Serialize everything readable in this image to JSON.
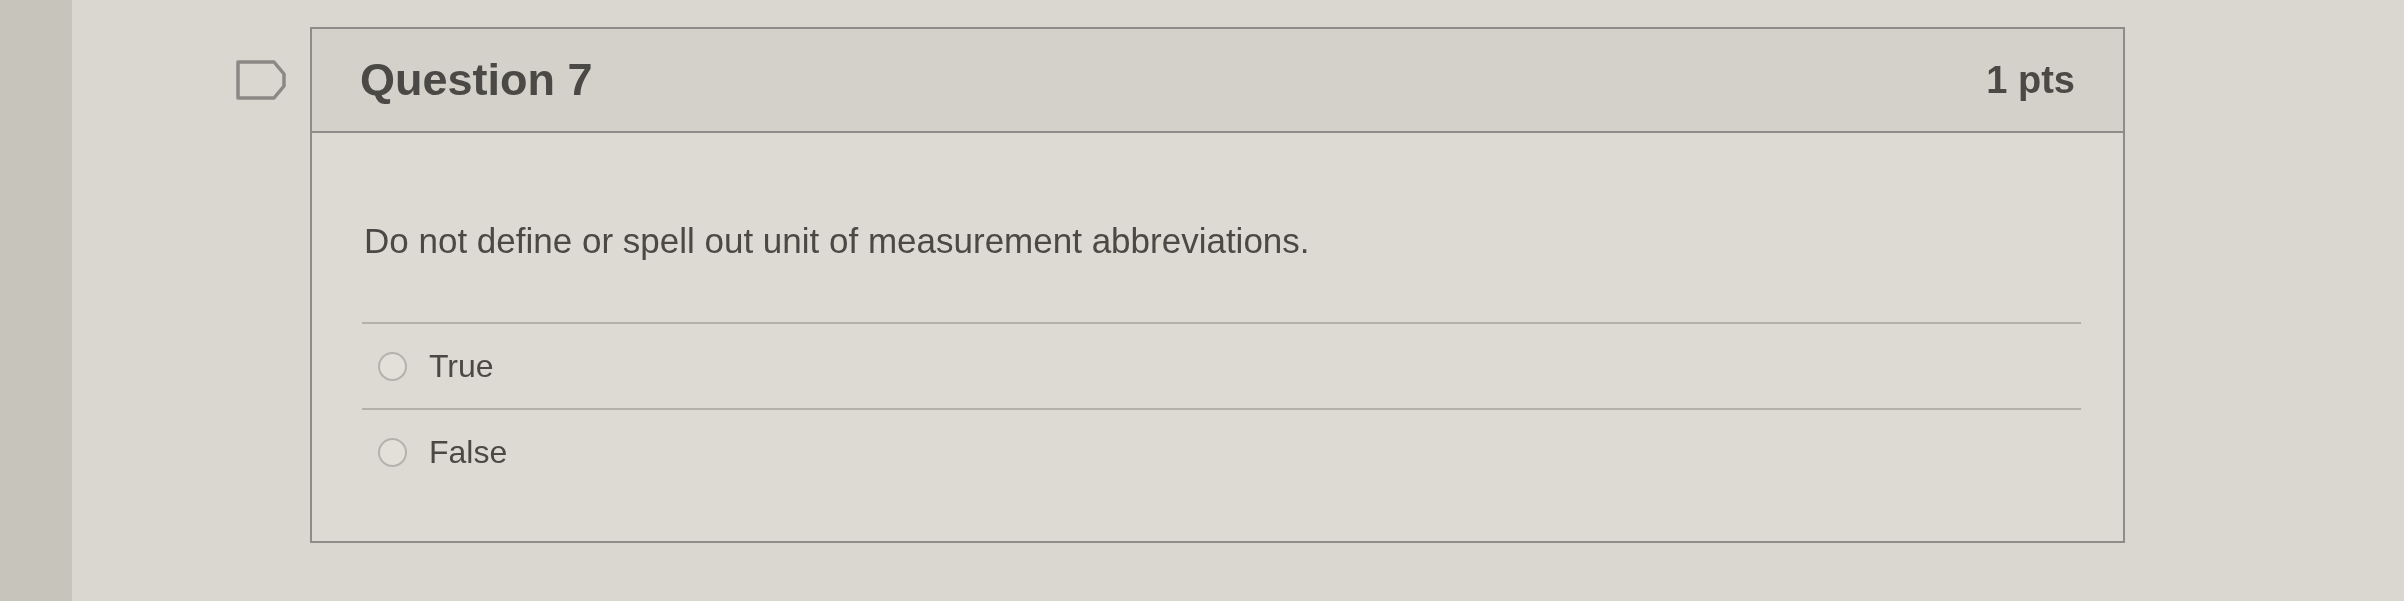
{
  "question": {
    "flagged": false,
    "title": "Question 7",
    "points": "1 pts",
    "text": "Do not define or spell out unit of measurement abbreviations.",
    "answers": [
      {
        "label": "True",
        "selected": false
      },
      {
        "label": "False",
        "selected": false
      }
    ]
  }
}
